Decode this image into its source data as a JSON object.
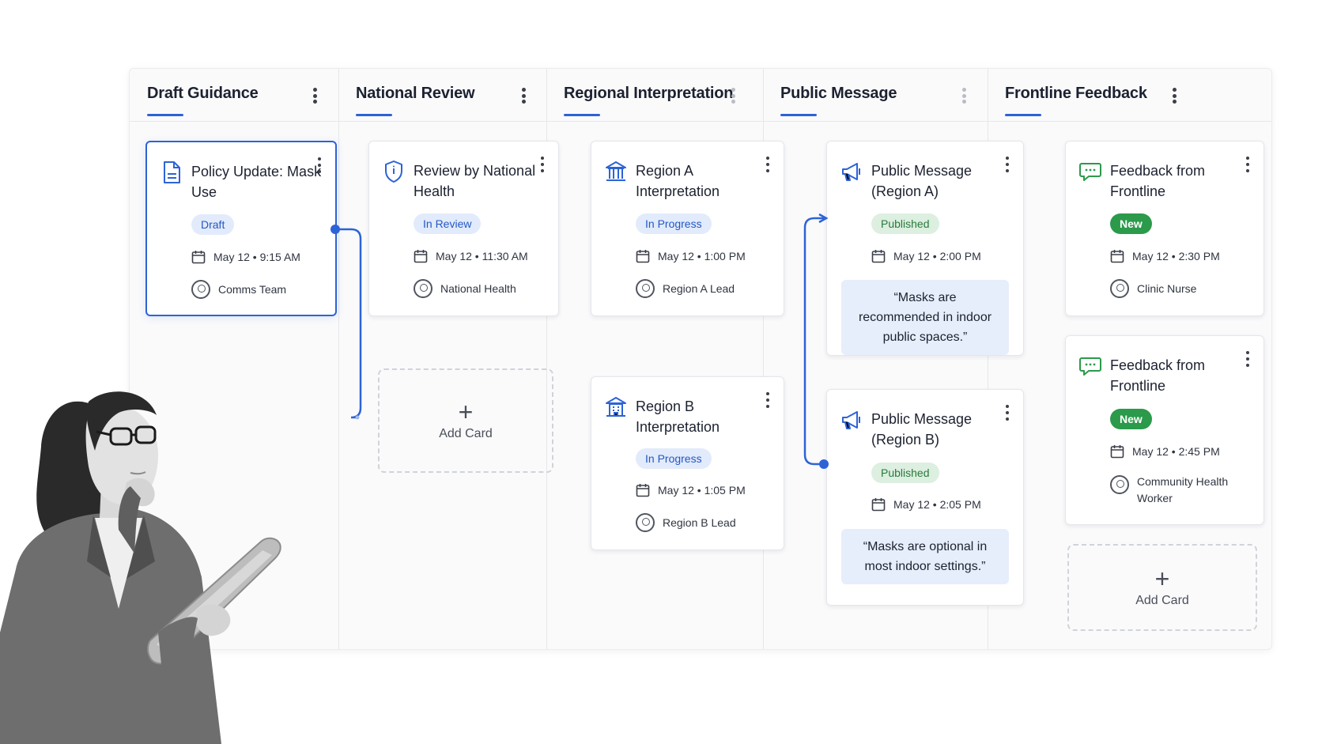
{
  "columns": [
    {
      "title": "Draft Guidance",
      "menu_icon": "kebab-icon"
    },
    {
      "title": "National Review",
      "menu_icon": "kebab-icon"
    },
    {
      "title": "Regional Interpretation",
      "menu_icon": "kebab-icon"
    },
    {
      "title": "Public Message",
      "menu_icon": "kebab-icon"
    },
    {
      "title": "Frontline Feedback",
      "menu_icon": "kebab-icon"
    }
  ],
  "cards": {
    "policy_update": {
      "icon": "document-icon",
      "title": "Policy Update: Mask Use",
      "status": "Draft",
      "date": "May 12 • 9:15 AM",
      "owner": "Comms Team"
    },
    "review_national": {
      "icon": "shield-icon",
      "title": "Review by National Health",
      "status": "In Review",
      "date": "May 12 • 11:30 AM",
      "owner": "National Health"
    },
    "region_a": {
      "icon": "government-building-icon",
      "title": "Region A Interpretation",
      "status": "In Progress",
      "date": "May 12 • 1:00 PM",
      "owner": "Region A Lead"
    },
    "region_b": {
      "icon": "office-building-icon",
      "title": "Region B Interpretation",
      "status": "In Progress",
      "date": "May 12 • 1:05 PM",
      "owner": "Region B Lead"
    },
    "public_a": {
      "icon": "megaphone-icon",
      "title": "Public Message (Region A)",
      "status": "Published",
      "date": "May 12 • 2:00 PM",
      "quote": "“Masks are recommended in indoor public spaces.”"
    },
    "public_b": {
      "icon": "megaphone-icon",
      "title": "Public Message (Region B)",
      "status": "Published",
      "date": "May 12 • 2:05 PM",
      "quote": "“Masks are optional in most indoor settings.”"
    },
    "feedback_1": {
      "icon": "chat-bubble-icon",
      "title": "Feedback from Frontline",
      "status": "New",
      "date": "May 12 • 2:30 PM",
      "owner": "Clinic Nurse"
    },
    "feedback_2": {
      "icon": "chat-bubble-icon",
      "title": "Feedback from Frontline",
      "status": "New",
      "date": "May 12 • 2:45 PM",
      "owner": "Community Health Worker"
    }
  },
  "add_card": {
    "plus": "+",
    "label": "Add Card"
  },
  "colors": {
    "accent": "#2d63d6",
    "published_bg": "#dcefe0",
    "new_bg": "#2b9a4a",
    "progress_bg": "#e2ebfb"
  }
}
